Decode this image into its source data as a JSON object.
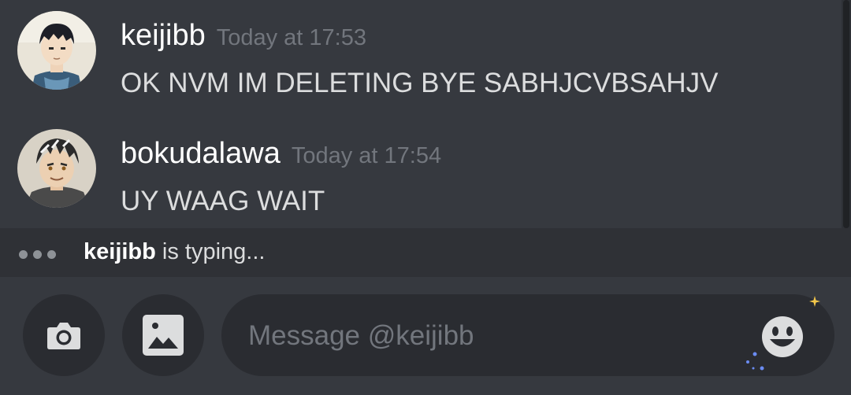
{
  "messages": [
    {
      "username": "keijibb",
      "timestamp": "Today at 17:53",
      "text": "OK NVM IM DELETING BYE SABHJCVBSAHJV",
      "avatar": "keijibb-avatar"
    },
    {
      "username": "bokudalawa",
      "timestamp": "Today at 17:54",
      "text": "UY WAAG WAIT",
      "avatar": "bokudalawa-avatar"
    }
  ],
  "typing": {
    "user": "keijibb",
    "suffix": " is typing..."
  },
  "composer": {
    "placeholder": "Message @keijibb",
    "icons": [
      "camera-icon",
      "image-icon",
      "emoji-icon"
    ]
  },
  "colors": {
    "background": "#36393f",
    "typing_bar": "#2f3136",
    "button_bg": "#2a2c31",
    "username": "#ffffff",
    "timestamp": "#72767d",
    "text": "#dcddde"
  }
}
